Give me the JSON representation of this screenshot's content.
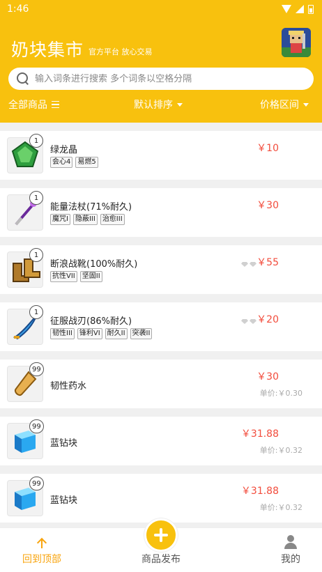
{
  "status": {
    "time": "1:46"
  },
  "app": {
    "title": "奶块集市",
    "subtitle": "官方平台 放心交易"
  },
  "search": {
    "placeholder": "输入词条进行搜索 多个词条以空格分隔"
  },
  "filters": {
    "all": "全部商品",
    "sort": "默认排序",
    "price_range": "价格区间"
  },
  "items": [
    {
      "name": "绿龙晶",
      "count": "1",
      "price": "￥10",
      "tags": [
        "会心4",
        "易燃5"
      ],
      "icon": "green-gem-icon"
    },
    {
      "name": "能量法杖(71%耐久)",
      "count": "1",
      "price": "￥30",
      "tags": [
        "魔咒I",
        "隐蔽III",
        "治愈III"
      ],
      "icon": "staff-icon"
    },
    {
      "name": "断浪战靴(100%耐久)",
      "count": "1",
      "price": "￥55",
      "tags": [
        "抗性VII",
        "坚固II"
      ],
      "icon": "boots-icon",
      "gems": true
    },
    {
      "name": "征服战刃(86%耐久)",
      "count": "1",
      "price": "￥20",
      "tags": [
        "韧性III",
        "锋利VI",
        "耐久II",
        "突袭II"
      ],
      "icon": "blade-icon",
      "gems": true
    },
    {
      "name": "韧性药水",
      "count": "99",
      "price": "￥30",
      "unit": "单价:￥0.30",
      "icon": "potion-icon"
    },
    {
      "name": "蓝钻块",
      "count": "99",
      "price": "￥31.88",
      "unit": "单价:￥0.32",
      "icon": "blue-block-icon"
    },
    {
      "name": "蓝钻块",
      "count": "99",
      "price": "￥31.88",
      "unit": "单价:￥0.32",
      "icon": "blue-block-icon"
    }
  ],
  "bottom": {
    "top": "回到顶部",
    "publish": "商品发布",
    "me": "我的"
  },
  "colors": {
    "brand": "#f8c10e",
    "price": "#f24c3c"
  }
}
